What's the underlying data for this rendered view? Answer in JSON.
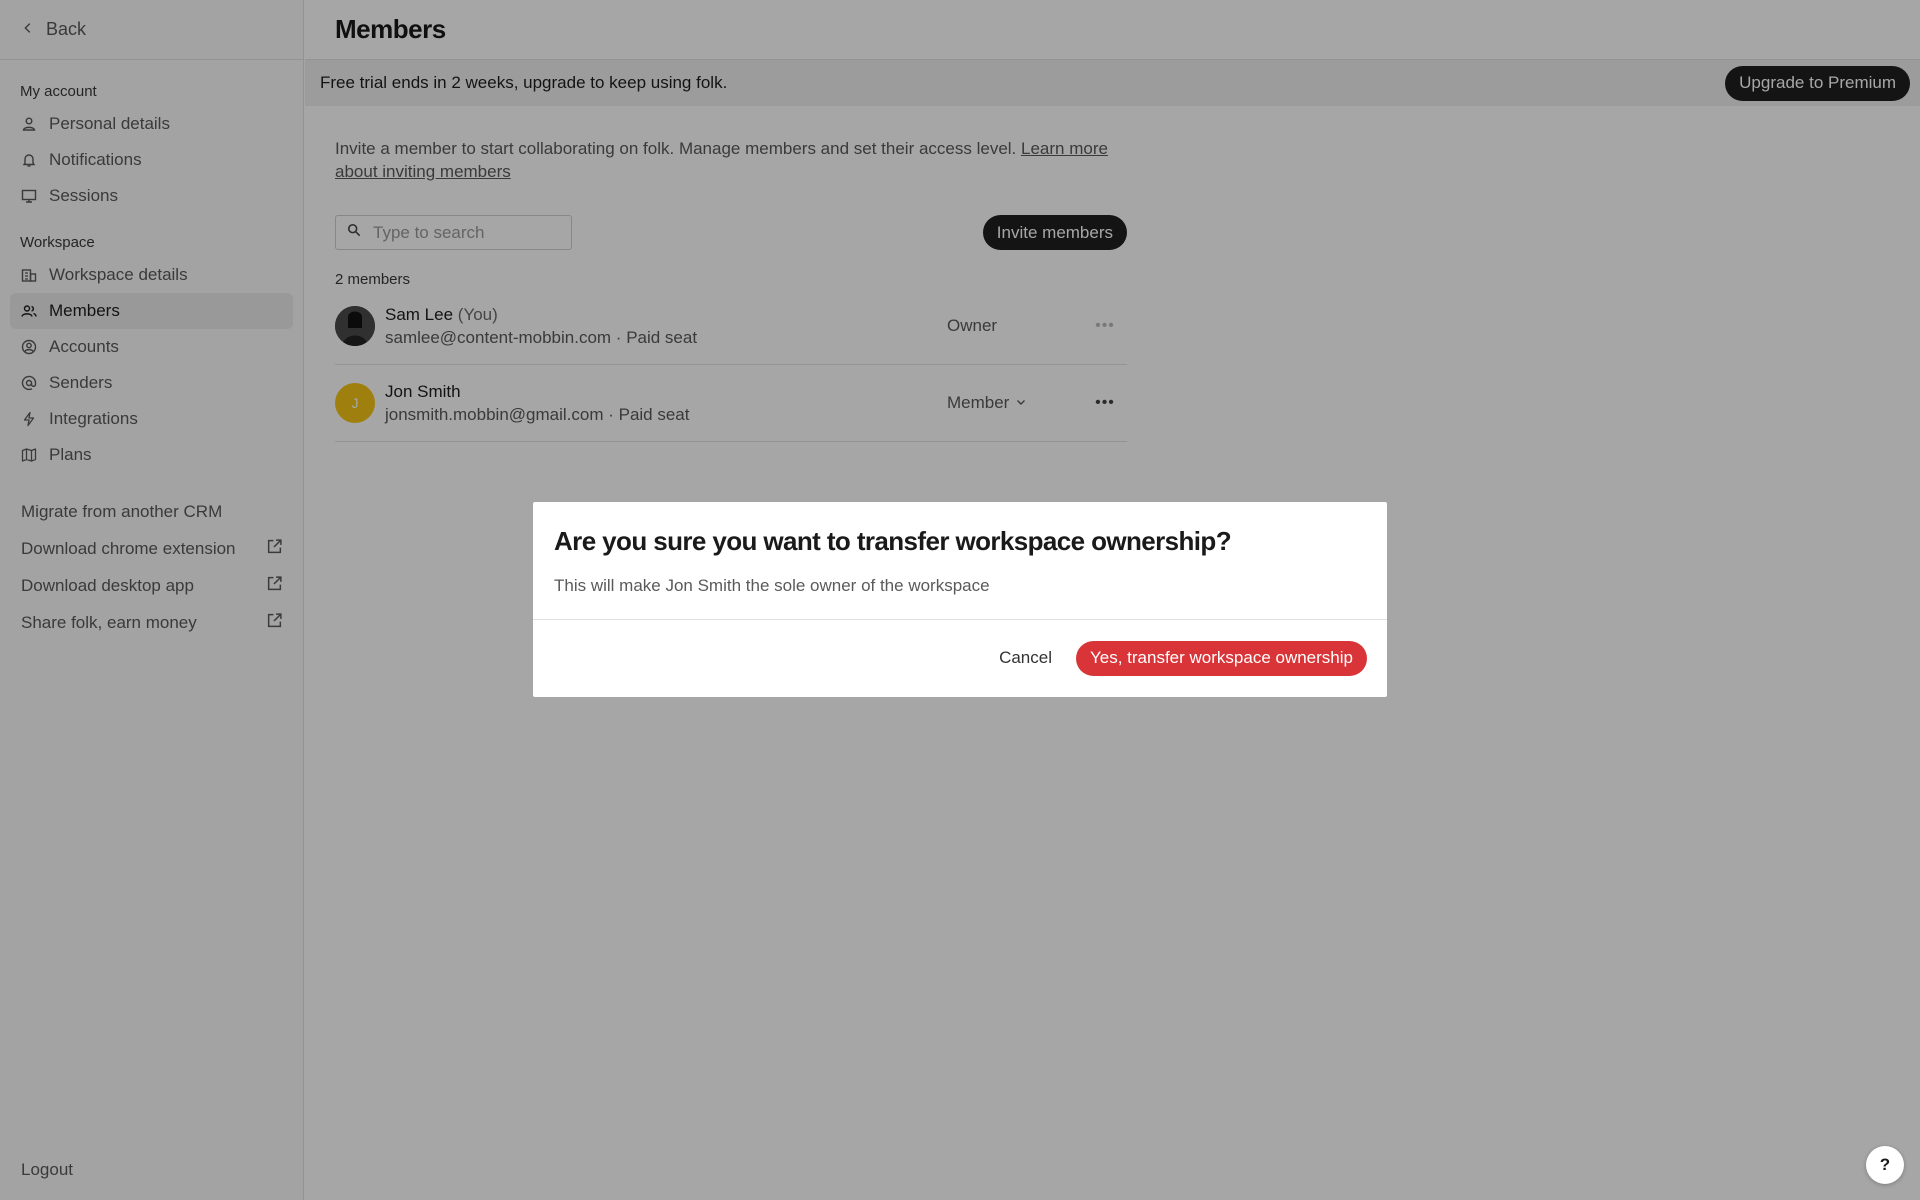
{
  "sidebar": {
    "back_label": "Back",
    "my_account_title": "My account",
    "my_account_items": [
      {
        "label": "Personal details",
        "icon": "person-icon"
      },
      {
        "label": "Notifications",
        "icon": "bell-icon"
      },
      {
        "label": "Sessions",
        "icon": "monitor-icon"
      }
    ],
    "workspace_title": "Workspace",
    "workspace_items": [
      {
        "label": "Workspace details",
        "icon": "building-icon"
      },
      {
        "label": "Members",
        "icon": "people-icon",
        "active": true
      },
      {
        "label": "Accounts",
        "icon": "user-circle-icon"
      },
      {
        "label": "Senders",
        "icon": "at-icon"
      },
      {
        "label": "Integrations",
        "icon": "bolt-icon"
      },
      {
        "label": "Plans",
        "icon": "map-icon"
      }
    ],
    "extra_links": [
      {
        "label": "Migrate from another CRM",
        "external": false
      },
      {
        "label": "Download chrome extension",
        "external": true
      },
      {
        "label": "Download desktop app",
        "external": true
      },
      {
        "label": "Share folk, earn money",
        "external": true
      }
    ],
    "logout_label": "Logout"
  },
  "header": {
    "title": "Members"
  },
  "trial_banner": {
    "text": "Free trial ends in 2 weeks, upgrade to keep using folk.",
    "button_label": "Upgrade to Premium"
  },
  "members_page": {
    "intro_text": "Invite a member to start collaborating on folk. Manage members and set their access level. ",
    "learn_more_link": "Learn more about inviting members",
    "search_placeholder": "Type to search",
    "invite_button_label": "Invite members",
    "member_count": "2 members",
    "members": [
      {
        "name": "Sam Lee",
        "you_tag": "(You)",
        "email_line": "samlee@content-mobbin.com · Paid seat",
        "role": "Owner",
        "avatar": "photo"
      },
      {
        "name": "Jon Smith",
        "you_tag": "",
        "email_line": "jonsmith.mobbin@gmail.com · Paid seat",
        "role": "Member",
        "avatar_initial": "J"
      }
    ]
  },
  "modal": {
    "title": "Are you sure you want to transfer workspace ownership?",
    "description": "This will make Jon Smith the sole owner of the workspace",
    "cancel_label": "Cancel",
    "confirm_label": "Yes, transfer workspace ownership"
  },
  "help_button_label": "?",
  "colors": {
    "danger": "#d93538",
    "dark_button": "#1f1f1f",
    "avatar_yellow": "#f5c518"
  }
}
